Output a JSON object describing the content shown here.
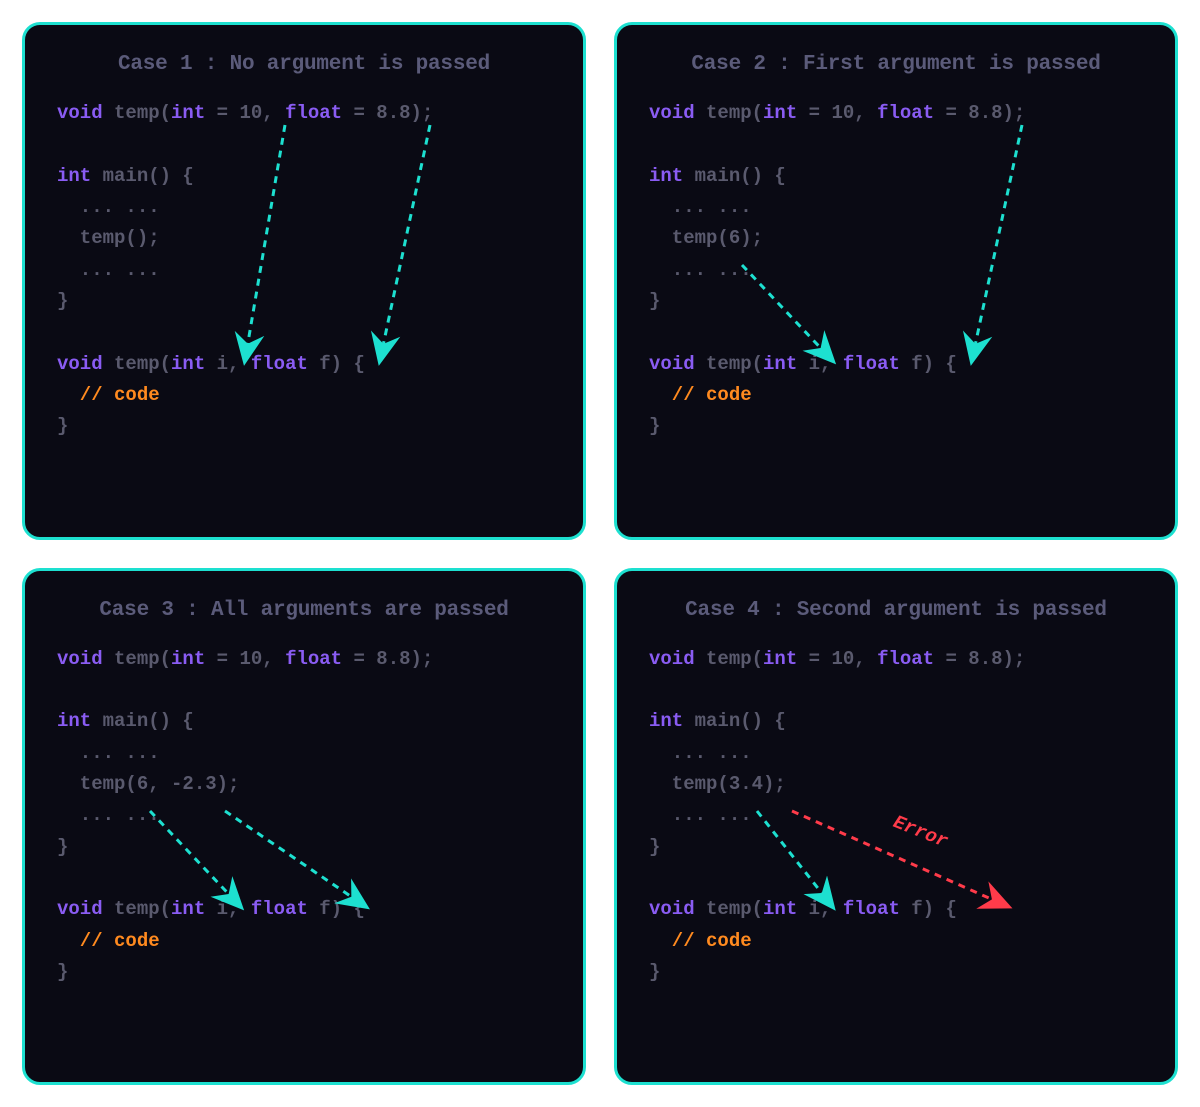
{
  "panels": {
    "case1": {
      "title": "Case 1 : No argument is passed",
      "decl_void": "void",
      "decl_name": " temp(",
      "decl_int": "int",
      "decl_eq1": " = 10, ",
      "decl_float": "float",
      "decl_eq2": " = 8.8);",
      "main_int": "int",
      "main_sig": " main() {",
      "dots1": "  ... ...",
      "call": "  temp();",
      "dots2": "  ... ...",
      "brace_close1": "}",
      "def_void": "void",
      "def_name": " temp(",
      "def_int": "int",
      "def_i": " i, ",
      "def_float": "float",
      "def_f": " f) {",
      "comment": "  // code",
      "brace_close2": "}"
    },
    "case2": {
      "title": "Case 2 : First argument is passed",
      "call": "  temp(6);"
    },
    "case3": {
      "title": "Case 3 : All arguments are passed",
      "call": "  temp(6, -2.3);"
    },
    "case4": {
      "title": "Case 4 : Second argument is passed",
      "call": "  temp(3.4);",
      "error_label": "Error"
    }
  },
  "colors": {
    "accent": "#1de0d0",
    "error": "#ff3b4a"
  }
}
